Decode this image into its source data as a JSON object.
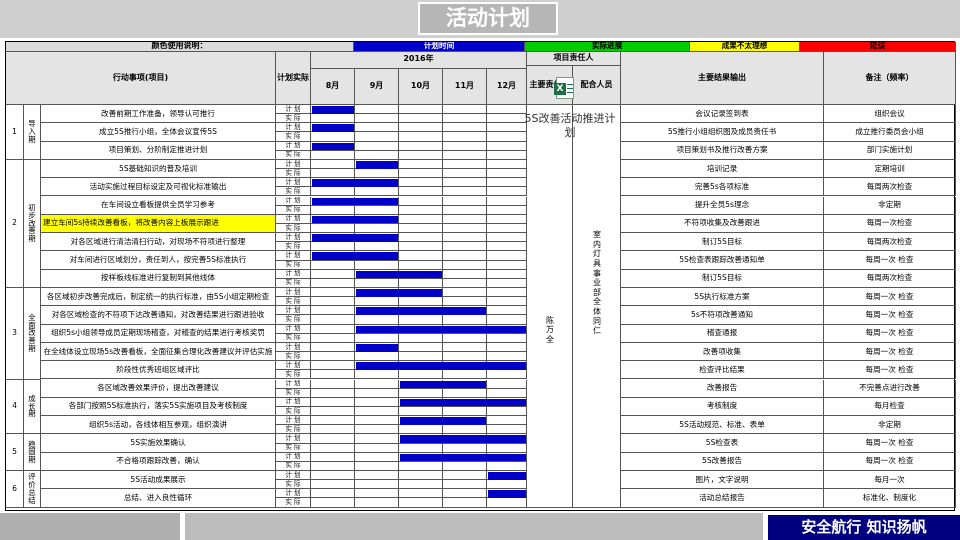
{
  "title": "活动计划",
  "legend": {
    "label": "颜色使用说明：",
    "items": [
      {
        "text": "计划时间",
        "color": "#0000c8",
        "text_color": "#ffffff"
      },
      {
        "text": "实际进展",
        "color": "#00cc00",
        "text_color": "#000000"
      },
      {
        "text": "成果不太理想",
        "color": "#ffff00",
        "text_color": "#000000"
      },
      {
        "text": "延误",
        "color": "#ff0000",
        "text_color": "#000000"
      }
    ]
  },
  "headers": {
    "item": "行动事项(项目)",
    "plan_actual": "计划实际",
    "year": "2016年",
    "months": [
      "8月",
      "9月",
      "10月",
      "11月",
      "12月"
    ],
    "owner_group": "项目责任人",
    "main_owner": "主要责任人",
    "cooperator": "配合人员",
    "output": "主要结果输出",
    "note": "备注（频率）"
  },
  "row_labels": {
    "plan": "计 划",
    "actual": "实 际"
  },
  "phases": [
    {
      "no": "1",
      "name": "导入期"
    },
    {
      "no": "2",
      "name": "初步改善期"
    },
    {
      "no": "3",
      "name": "全面改善期"
    },
    {
      "no": "4",
      "name": "成长期"
    },
    {
      "no": "5",
      "name": "稳固期"
    },
    {
      "no": "6",
      "name": "评价总结"
    }
  ],
  "rows": [
    {
      "item": "改善前期工作准备，领导认可推行",
      "plan_months": [
        1,
        1
      ],
      "output": "会议记录签到表",
      "note": "组织会议"
    },
    {
      "item": "成立5S推行小组，全体会议宣传5S",
      "plan_months": [
        1,
        1
      ],
      "output": "5S推行小组组织图及成员责任书",
      "note": "成立推行委员会小组"
    },
    {
      "item": "项目策划、分阶制定推进计划",
      "plan_months": [
        1,
        1
      ],
      "output": "项目策划书及推行改善方案",
      "note": "部门实施计划"
    },
    {
      "item": "5S基础知识的普及培训",
      "plan_months": [
        2,
        2
      ],
      "output": "培训记录",
      "note": "定期培训"
    },
    {
      "item": "活动实施过程目标设定及可视化标准输出",
      "plan_months": [
        1,
        2
      ],
      "output": "完善5s各项标准",
      "note": "每周两次检查"
    },
    {
      "item": "在车间设立看板提供全员学习参考",
      "plan_months": [
        1,
        2
      ],
      "output": "提升全员5s理念",
      "note": "非定期"
    },
    {
      "item": "建立车间5s持续改善看板，将改善内容上板展示跟进",
      "plan_months": [
        1,
        2
      ],
      "highlight": "#ffff00",
      "output": "不符项收集及改善跟进",
      "note": "每周一次检查"
    },
    {
      "item": "对各区域进行清洁清扫行动，对现场不符项进行整理",
      "plan_months": [
        1,
        2
      ],
      "output": "制订5S目标",
      "note": "每周两次检查"
    },
    {
      "item": "对车间进行区域划分，责任到人，按完善5S标准执行",
      "plan_months": [
        1,
        2
      ],
      "output": "5S检查表跟踪改善通知单",
      "note": "每周一次 检查"
    },
    {
      "item": "按样板线标准进行复制到其他线体",
      "plan_months": [
        2,
        3
      ],
      "output": "制订5S目标",
      "note": "每周两次检查"
    },
    {
      "item": "各区域初步改善完成后，制定统一的执行标准，由5S小组定期检查",
      "plan_months": [
        2,
        3
      ],
      "output": "5S执行标准方案",
      "note": "每周一次 检查"
    },
    {
      "item": "对各区域检查的不符项下达改善通知，对改善结果进行跟进验收",
      "plan_months": [
        2,
        4
      ],
      "output": "5s不符项改善通知",
      "note": "每周一次 检查"
    },
    {
      "item": "组织5s小组领导成员定期现场稽查，对稽查的结果进行考核奖罚",
      "plan_months": [
        2,
        5
      ],
      "output": "稽查通报",
      "note": "每周一次 检查"
    },
    {
      "item": "在全线体设立现场5s改善看板，全面征集合理化改善建议并评估实施",
      "plan_months": [
        2,
        2
      ],
      "output": "改善项收集",
      "note": "每周一次 检查"
    },
    {
      "item": "阶段性优秀班组区域评比",
      "plan_months": [
        2,
        5
      ],
      "output": "检查评比结果",
      "note": "每周一次 检查"
    },
    {
      "item": "各区域改善效果评价，提出改善建议",
      "plan_months": [
        3,
        4
      ],
      "output": "改善报告",
      "note": "不完善点进行改善"
    },
    {
      "item": "各部门按照5S标准执行，落实5S实施项目及考核制度",
      "plan_months": [
        3,
        5
      ],
      "output": "考核制度",
      "note": "每月检查"
    },
    {
      "item": "组织5s活动，各线体相互参观，组织演讲",
      "plan_months": [
        3,
        4
      ],
      "output": "5S活动规范、标准、表单",
      "note": "非定期"
    },
    {
      "item": "5S实施效果确认",
      "plan_months": [
        3,
        5
      ],
      "output": "5S检查表",
      "note": "每周一次 检查"
    },
    {
      "item": "不合格项跟踪改善，确认",
      "plan_months": [
        3,
        5
      ],
      "output": "5S改善报告",
      "note": "每周一次 检查"
    },
    {
      "item": "5S活动成果展示",
      "plan_months": [
        5,
        5
      ],
      "output": "图片，文字说明",
      "note": "每月一次"
    },
    {
      "item": "总结、进入良性循环",
      "plan_months": [
        5,
        5
      ],
      "output": "活动总结报告",
      "note": "标准化、制度化"
    }
  ],
  "main_owner_text": "陈万全",
  "cooperator_text": "室内灯具事业部全体同仁",
  "embedded_file": {
    "name": "5S改善活动推进计划"
  },
  "footer_slogan": "安全航行 知识扬帆"
}
